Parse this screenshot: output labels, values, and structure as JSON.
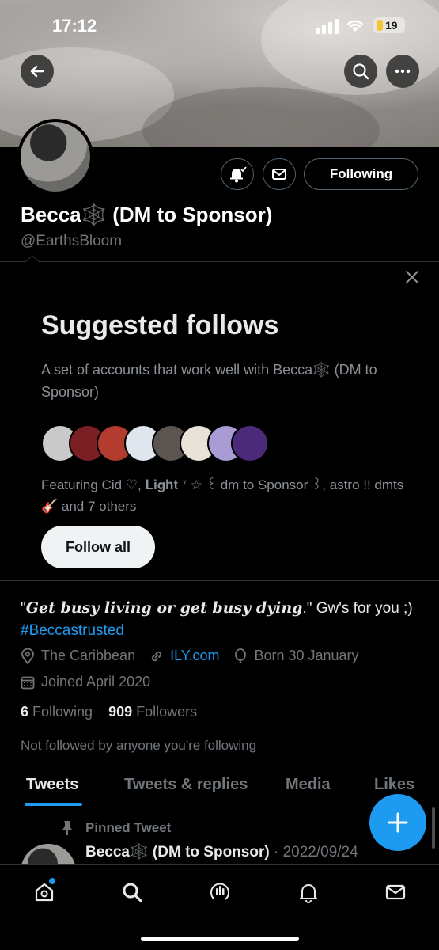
{
  "status_bar": {
    "time": "17:12",
    "battery": "19"
  },
  "profile": {
    "name": "Becca🕸️ (DM to Sponsor)",
    "handle": "@EarthsBloom",
    "following_button": "Following"
  },
  "suggested": {
    "title": "Suggested follows",
    "description": "A set of accounts that work well with Becca🕸️ (DM to Sponsor)",
    "featuring": "Featuring Cid ♡, 𝐋𝐢𝐠𝐡𝐭 ⁷ ☆ ꒰ dm to Sponsor ꒱, astro !! dmts 🎸 and 7 others",
    "follow_all": "Follow all",
    "face_colors": [
      "#c9c9c9",
      "#7a1f24",
      "#b33b2f",
      "#dfe6ee",
      "#5c5450",
      "#e9e2d6",
      "#a99bd4",
      "#4b2a7a"
    ]
  },
  "bio": {
    "quote_open": "\"",
    "quote_em": "Get busy living or get busy dying",
    "quote_rest": ".\" Gw's for you ;)",
    "hashtag": "#Beccastrusted"
  },
  "meta": {
    "location": "The Caribbean",
    "website": "ILY.com",
    "birthday": "Born 30 January",
    "joined": "Joined April 2020"
  },
  "counts": {
    "following_num": "6",
    "following_label": "Following",
    "followers_num": "909",
    "followers_label": "Followers",
    "not_followed": "Not followed by anyone you're following"
  },
  "tabs": [
    "Tweets",
    "Tweets & replies",
    "Media",
    "Likes"
  ],
  "pinned": {
    "label": "Pinned Tweet",
    "name": "Becca🕸️ (DM to Sponsor)",
    "date": "· 2022/09/24"
  },
  "colors": {
    "accent": "#1d9bf0",
    "background": "#000000",
    "muted": "#71767b"
  }
}
